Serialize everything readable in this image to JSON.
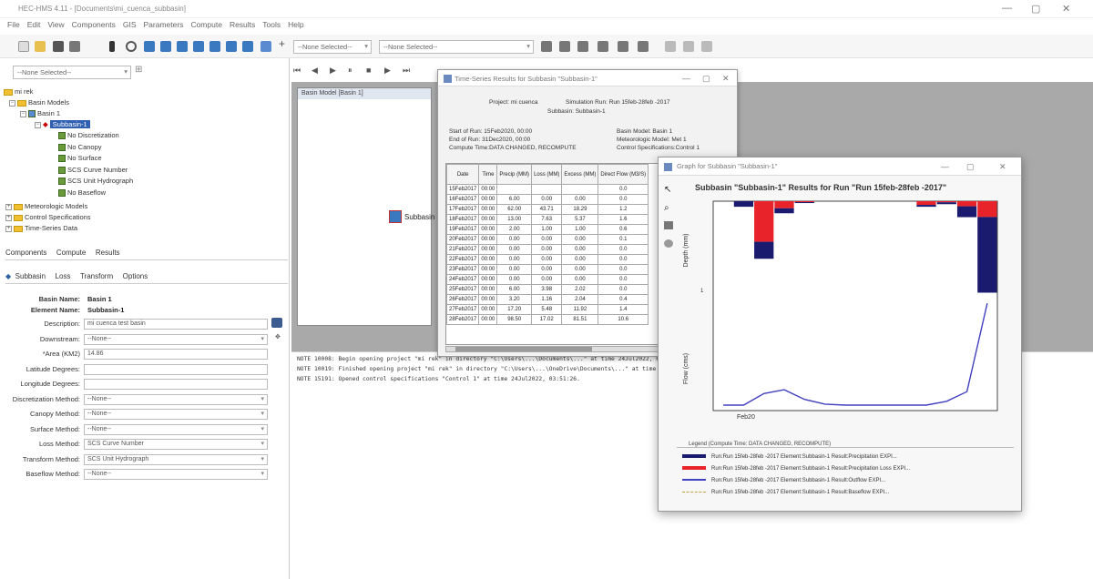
{
  "window": {
    "title": "HEC-HMS 4.11 - [Documents\\mi_cuenca_subbasin]",
    "minimize": "—",
    "maximize": "▢",
    "close": "✕"
  },
  "menu": [
    "File",
    "Edit",
    "View",
    "Components",
    "GIS",
    "Parameters",
    "Compute",
    "Results",
    "Tools",
    "Help"
  ],
  "toolbar": {
    "run_select": "--None Selected--",
    "run_select2": "--None Selected--",
    "left_select": "--None Selected--"
  },
  "tree": {
    "root": "mi rek",
    "basin_models": "Basin Models",
    "basin": "Basin 1",
    "subbasin": "Subbasin-1",
    "children": [
      "No Discretization",
      "No Canopy",
      "No Surface",
      "SCS Curve Number",
      "SCS Unit Hydrograph",
      "No Baseflow"
    ],
    "met": "Meteorologic Models",
    "control": "Control Specifications",
    "ts": "Time-Series Data"
  },
  "lower_tabs": [
    "Components",
    "Compute",
    "Results"
  ],
  "prop_tabs": [
    "Subbasin",
    "Loss",
    "Transform",
    "Options"
  ],
  "props": {
    "basin_name_label": "Basin Name:",
    "basin_name": "Basin 1",
    "element_name_label": "Element Name:",
    "element_name": "Subbasin-1",
    "fields": [
      {
        "label": "Description:",
        "value": "mi cuenca test basin",
        "dropdown": false
      },
      {
        "label": "Downstream:",
        "value": "--None--",
        "dropdown": true
      },
      {
        "label": "*Area (KM2)",
        "value": "14.86",
        "dropdown": false
      },
      {
        "label": "Latitude Degrees:",
        "value": "",
        "dropdown": false
      },
      {
        "label": "Longitude Degrees:",
        "value": "",
        "dropdown": false
      },
      {
        "label": "Discretization Method:",
        "value": "--None--",
        "dropdown": true
      },
      {
        "label": "Canopy Method:",
        "value": "--None--",
        "dropdown": true
      },
      {
        "label": "Surface Method:",
        "value": "--None--",
        "dropdown": true
      },
      {
        "label": "Loss Method:",
        "value": "SCS Curve Number",
        "dropdown": true
      },
      {
        "label": "Transform Method:",
        "value": "SCS Unit Hydrograph",
        "dropdown": true
      },
      {
        "label": "Baseflow Method:",
        "value": "--None--",
        "dropdown": true
      }
    ]
  },
  "basin_window": {
    "title": "Basin Model [Basin 1]",
    "element": "Subbasin"
  },
  "console": [
    "NOTE 10008:  Begin opening project \"mi rek\" in directory \"C:\\Users\\...\\Documents\\...\" at time 24Jul2022, 03:51:26.",
    "NOTE 10019:  Finished opening project \"mi rek\" in directory \"C:\\Users\\...\\OneDrive\\Documents\\...\" at time 24Jul2022, 03:51:26.",
    "NOTE 15191:  Opened control specifications \"Control 1\" at time 24Jul2022, 03:51:26."
  ],
  "ts_window": {
    "title": "Time-Series Results for Subbasin \"Subbasin-1\"",
    "project": "Project: mi cuenca",
    "run": "Simulation Run: Run  15feb-28feb -2017",
    "subbasin": "Subbasin: Subbasin-1",
    "start": "Start of Run:      15Feb2020, 00:00",
    "end": "End of Run:        31Dec2020, 00:00",
    "compute": "Compute Time:DATA CHANGED, RECOMPUTE",
    "basin_model": "Basin Model:                Basin 1",
    "met_model": "Meteorologic Model:       Met 1",
    "control": "Control Specifications:Control 1",
    "headers": [
      "Date",
      "Time",
      "Precip (MM)",
      "Loss (MM)",
      "Excess (MM)",
      "Direct Flow (M3/S)"
    ],
    "rows": [
      [
        "15Feb2017",
        "00:00",
        "",
        "",
        "",
        "0.0"
      ],
      [
        "16Feb2017",
        "00:00",
        "6.00",
        "0.00",
        "0.00",
        "0.0"
      ],
      [
        "17Feb2017",
        "00:00",
        "62.00",
        "43.71",
        "18.29",
        "1.2"
      ],
      [
        "18Feb2017",
        "00:00",
        "13.00",
        "7.63",
        "5.37",
        "1.6"
      ],
      [
        "19Feb2017",
        "00:00",
        "2.00",
        "1.00",
        "1.00",
        "0.6"
      ],
      [
        "20Feb2017",
        "00:00",
        "0.00",
        "0.00",
        "0.00",
        "0.1"
      ],
      [
        "21Feb2017",
        "00:00",
        "0.00",
        "0.00",
        "0.00",
        "0.0"
      ],
      [
        "22Feb2017",
        "00:00",
        "0.00",
        "0.00",
        "0.00",
        "0.0"
      ],
      [
        "23Feb2017",
        "00:00",
        "0.00",
        "0.00",
        "0.00",
        "0.0"
      ],
      [
        "24Feb2017",
        "00:00",
        "0.00",
        "0.00",
        "0.00",
        "0.0"
      ],
      [
        "25Feb2017",
        "00:00",
        "6.00",
        "3.98",
        "2.02",
        "0.0"
      ],
      [
        "26Feb2017",
        "00:00",
        "3.20",
        "1.16",
        "2.04",
        "0.4"
      ],
      [
        "27Feb2017",
        "00:00",
        "17.20",
        "5.48",
        "11.92",
        "1.4"
      ],
      [
        "28Feb2017",
        "00:00",
        "98.50",
        "17.02",
        "81.51",
        "10.6"
      ]
    ]
  },
  "graph_window": {
    "title": "Graph for Subbasin \"Subbasin-1\"",
    "chart_title": "Subbasin \"Subbasin-1\" Results for Run \"Run  15feb-28feb -2017\"",
    "depth_label": "Depth (mm)",
    "flow_label": "Flow (cms)",
    "x_tick": "Feb20",
    "legend_title": "Legend (Compute Time: DATA CHANGED, RECOMPUTE)",
    "legend": [
      {
        "text": "Run:Run  15feb-28feb -2017 Element:Subbasin-1 Result:Precipitation EXPI...",
        "color": "#1a1a6e",
        "style": "thick"
      },
      {
        "text": "Run:Run  15feb-28feb -2017 Element:Subbasin-1 Result:Precipitation Loss EXPI...",
        "color": "#e8232a",
        "style": "thick"
      },
      {
        "text": "Run:Run  15feb-28feb -2017 Element:Subbasin-1 Result:Outflow EXPI...",
        "color": "#4040c0",
        "style": "line"
      },
      {
        "text": "Run:Run  15feb-28feb -2017 Element:Subbasin-1 Result:Baseflow EXPI...",
        "color": "#c0a040",
        "style": "dash"
      }
    ]
  },
  "chart_data": {
    "type": "bar",
    "categories": [
      "15Feb2017",
      "16Feb2017",
      "17Feb2017",
      "18Feb2017",
      "19Feb2017",
      "20Feb2017",
      "21Feb2017",
      "22Feb2017",
      "23Feb2017",
      "24Feb2017",
      "25Feb2017",
      "26Feb2017",
      "27Feb2017",
      "28Feb2017"
    ],
    "series": [
      {
        "name": "Precipitation",
        "values": [
          0,
          6.0,
          62.0,
          13.0,
          2.0,
          0,
          0,
          0,
          0,
          0,
          6.0,
          3.2,
          17.2,
          98.5
        ]
      },
      {
        "name": "Precipitation Loss",
        "values": [
          0,
          0.0,
          43.71,
          7.63,
          1.0,
          0,
          0,
          0,
          0,
          0,
          3.98,
          1.16,
          5.48,
          17.02
        ]
      },
      {
        "name": "Outflow",
        "values": [
          0.0,
          0.0,
          1.2,
          1.6,
          0.6,
          0.1,
          0.0,
          0.0,
          0.0,
          0.0,
          0.0,
          0.4,
          1.4,
          10.6
        ]
      }
    ],
    "title": "Subbasin \"Subbasin-1\" Results for Run \"Run  15feb-28feb -2017\"",
    "xlabel": "Feb20",
    "ylabel": "Flow (cms)",
    "ylabel_top": "Depth (mm)",
    "grid": true
  }
}
